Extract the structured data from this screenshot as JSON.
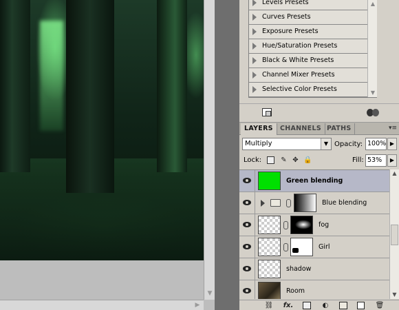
{
  "adjustments": {
    "presets": [
      {
        "label": "Levels Presets"
      },
      {
        "label": "Curves Presets"
      },
      {
        "label": "Exposure Presets"
      },
      {
        "label": "Hue/Saturation Presets"
      },
      {
        "label": "Black & White Presets"
      },
      {
        "label": "Channel Mixer Presets"
      },
      {
        "label": "Selective Color Presets"
      }
    ]
  },
  "layers_panel": {
    "tabs": [
      {
        "label": "LAYERS",
        "active": true
      },
      {
        "label": "CHANNELS",
        "active": false
      },
      {
        "label": "PATHS",
        "active": false
      }
    ],
    "panel_menu_icon": "panel-menu-icon",
    "blend_mode": "Multiply",
    "opacity_label": "Opacity:",
    "opacity_value": "100%",
    "lock_label": "Lock:",
    "fill_label": "Fill:",
    "fill_value": "53%",
    "layers": [
      {
        "name": "Green blending",
        "selected": true,
        "visible": true
      },
      {
        "name": "Blue blending",
        "selected": false,
        "visible": true,
        "is_group": true
      },
      {
        "name": "fog",
        "selected": false,
        "visible": true
      },
      {
        "name": "Girl",
        "selected": false,
        "visible": true
      },
      {
        "name": "shadow",
        "selected": false,
        "visible": true
      },
      {
        "name": "Room",
        "selected": false,
        "visible": true
      }
    ],
    "footer_icons": [
      "link-layers-icon",
      "layer-style-icon",
      "add-mask-icon",
      "adjustment-layer-icon",
      "new-group-icon",
      "new-layer-icon",
      "delete-layer-icon"
    ],
    "footer_fx_label": "fx."
  },
  "colors": {
    "panel_bg": "#d4d0c8",
    "selected_layer": "#b6b8c8",
    "green_fill": "#00e000",
    "dock_bg": "#6e6e6e"
  }
}
